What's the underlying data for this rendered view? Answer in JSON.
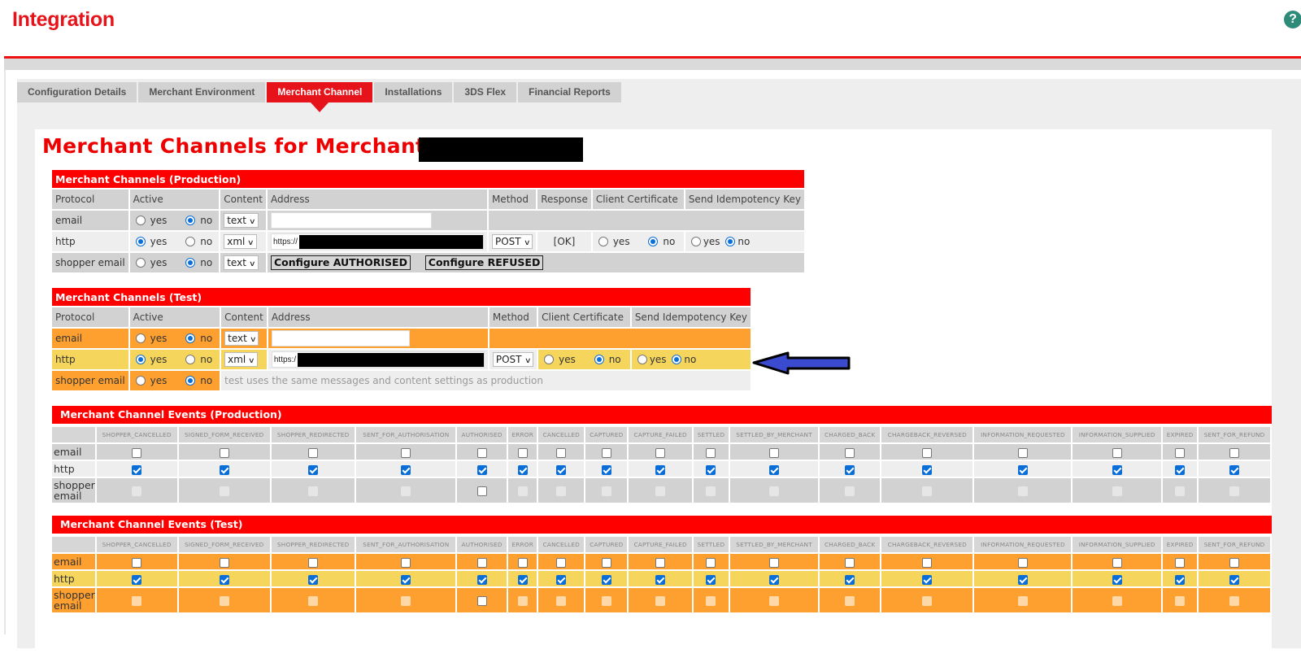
{
  "header": {
    "title": "Integration",
    "help_icon": "question-circle-icon"
  },
  "tabs": [
    {
      "label": "Configuration Details",
      "active": false
    },
    {
      "label": "Merchant Environment",
      "active": false
    },
    {
      "label": "Merchant Channel",
      "active": true
    },
    {
      "label": "Installations",
      "active": false
    },
    {
      "label": "3DS Flex",
      "active": false
    },
    {
      "label": "Financial Reports",
      "active": false
    }
  ],
  "page": {
    "title": "Merchant Channels for Merchant",
    "merchant_name": "[redacted]"
  },
  "production_channels": {
    "title": "Merchant Channels (Production)",
    "columns": [
      "Protocol",
      "Active",
      "Content",
      "Address",
      "Method",
      "Response",
      "Client Certificate",
      "Send Idempotency Key"
    ],
    "yes_label": "yes",
    "no_label": "no",
    "rows": {
      "email": {
        "protocol": "email",
        "active": "no",
        "content": "text",
        "address": ""
      },
      "http": {
        "protocol": "http",
        "active": "yes",
        "content": "xml",
        "address": "https://[redacted]",
        "method": "POST",
        "response": "[OK]",
        "client_certificate": "no",
        "send_idempotency_key": "no"
      },
      "shopper_email": {
        "protocol": "shopper email",
        "active": "no",
        "content": "text",
        "configure_authorised": "Configure AUTHORISED",
        "configure_refused": "Configure REFUSED"
      }
    }
  },
  "test_channels": {
    "title": "Merchant Channels (Test)",
    "columns": [
      "Protocol",
      "Active",
      "Content",
      "Address",
      "Method",
      "Client Certificate",
      "Send Idempotency Key"
    ],
    "yes_label": "yes",
    "no_label": "no",
    "rows": {
      "email": {
        "protocol": "email",
        "active": "no",
        "content": "text",
        "address": ""
      },
      "http": {
        "protocol": "http",
        "active": "yes",
        "content": "xml",
        "address": "https:/[redacted]",
        "method": "POST",
        "client_certificate": "no",
        "send_idempotency_key": "no"
      },
      "shopper_email": {
        "protocol": "shopper email",
        "active": "no",
        "note": "test uses the same messages and content settings as production"
      }
    }
  },
  "event_columns": [
    "SHOPPER_CANCELLED",
    "SIGNED_FORM_RECEIVED",
    "SHOPPER_REDIRECTED",
    "SENT_FOR_AUTHORISATION",
    "AUTHORISED",
    "ERROR",
    "CANCELLED",
    "CAPTURED",
    "CAPTURE_FAILED",
    "SETTLED",
    "SETTLED_BY_MERCHANT",
    "CHARGED_BACK",
    "CHARGEBACK_REVERSED",
    "INFORMATION_REQUESTED",
    "INFORMATION_SUPPLIED",
    "EXPIRED",
    "SENT_FOR_REFUND"
  ],
  "production_events": {
    "title": "Merchant Channel Events (Production)",
    "rows": [
      {
        "label": "email",
        "states": [
          "off",
          "off",
          "off",
          "off",
          "off",
          "off",
          "off",
          "off",
          "off",
          "off",
          "off",
          "off",
          "off",
          "off",
          "off",
          "off",
          "off"
        ]
      },
      {
        "label": "http",
        "states": [
          "on",
          "on",
          "on",
          "on",
          "on",
          "on",
          "on",
          "on",
          "on",
          "on",
          "on",
          "on",
          "on",
          "on",
          "on",
          "on",
          "on"
        ]
      },
      {
        "label": "shopper email",
        "states": [
          "disabled",
          "disabled",
          "disabled",
          "disabled",
          "off",
          "disabled",
          "disabled",
          "disabled",
          "disabled",
          "disabled",
          "disabled",
          "disabled",
          "disabled",
          "disabled",
          "disabled",
          "disabled",
          "disabled"
        ]
      }
    ]
  },
  "test_events": {
    "title": "Merchant Channel Events (Test)",
    "rows": [
      {
        "label": "email",
        "states": [
          "off",
          "off",
          "off",
          "off",
          "off",
          "off",
          "off",
          "off",
          "off",
          "off",
          "off",
          "off",
          "off",
          "off",
          "off",
          "off",
          "off"
        ]
      },
      {
        "label": "http",
        "states": [
          "on",
          "on",
          "on",
          "on",
          "on",
          "on",
          "on",
          "on",
          "on",
          "on",
          "on",
          "on",
          "on",
          "on",
          "on",
          "on",
          "on"
        ]
      },
      {
        "label": "shopper email",
        "states": [
          "disabled",
          "disabled",
          "disabled",
          "disabled",
          "off",
          "disabled",
          "disabled",
          "disabled",
          "disabled",
          "disabled",
          "disabled",
          "disabled",
          "disabled",
          "disabled",
          "disabled",
          "disabled",
          "disabled"
        ]
      }
    ]
  },
  "annotation": {
    "arrow_color": "#3b4bd0",
    "arrow_direction": "left",
    "points_to": "test http row"
  },
  "colors": {
    "brand_red": "#e6131a",
    "section_red": "#ff0000",
    "test_orange": "#fda030",
    "test_yellow": "#f5d55c",
    "checkbox_blue": "#0a6ed8"
  }
}
